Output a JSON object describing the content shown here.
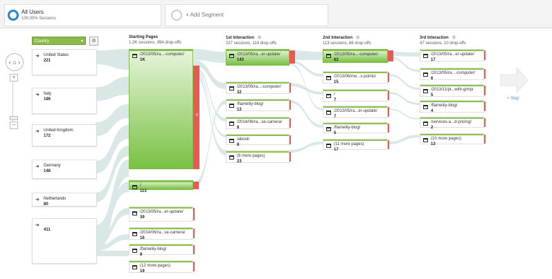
{
  "segments": {
    "all_users": {
      "title": "All Users",
      "subtitle": "100.00% Sessions"
    },
    "add_segment": {
      "label": "+ Add Segment"
    }
  },
  "dimension": {
    "selector_label": "Country",
    "nodes": [
      {
        "name": "United States",
        "count": "221"
      },
      {
        "name": "Italy",
        "count": "189"
      },
      {
        "name": "United Kingdom",
        "count": "172"
      },
      {
        "name": "Germany",
        "count": "148"
      },
      {
        "name": "Netherlands",
        "count": "80"
      },
      {
        "name": "",
        "count": "411"
      }
    ]
  },
  "columns": [
    {
      "title": "Starting Pages",
      "stats": "1.2K sessions, 994 drop-offs",
      "has_icon": false
    },
    {
      "title": "1st Interaction",
      "stats": "227 sessions, 114 drop-offs",
      "has_icon": true
    },
    {
      "title": "2nd Interaction",
      "stats": "113 sessions, 66 drop-offs",
      "has_icon": true
    },
    {
      "title": "3rd Interaction",
      "stats": "47 sessions, 10 drop-offs",
      "has_icon": true
    }
  ],
  "starting_pages": [
    {
      "label": "/2013/05/ra...-computer/",
      "value": "1K"
    },
    {
      "label": "/",
      "value": "113"
    },
    {
      "label": "/2013/05/ra...er-update/",
      "value": "39"
    },
    {
      "label": "/2014/06/ra...se-camera/",
      "value": "16"
    },
    {
      "label": "/flameliiy-blog/",
      "value": "8"
    },
    {
      "label": "(12 more pages)",
      "value": "19"
    }
  ],
  "first_interaction": [
    {
      "label": "/2013/05/ra...er-update/",
      "value": "143"
    },
    {
      "label": "/2013/05/ra...-computer/",
      "value": "32"
    },
    {
      "label": "/flameliiy-blog/",
      "value": "13"
    },
    {
      "label": "/2014/06/ra...se-camera/",
      "value": "8"
    },
    {
      "label": "/about/",
      "value": "8"
    },
    {
      "label": "(9 more pages)",
      "value": "23"
    }
  ],
  "second_interaction": [
    {
      "label": "/2013/05/ra...-computer/",
      "value": "62"
    },
    {
      "label": "/2013/06/me...s-points/",
      "value": "15"
    },
    {
      "label": "/",
      "value": "7"
    },
    {
      "label": "/2013/05/ra...er-update/",
      "value": "7"
    },
    {
      "label": "/flameliiy-blog/",
      "value": "5"
    },
    {
      "label": "(11 more pages)",
      "value": "17"
    }
  ],
  "third_interaction": [
    {
      "label": "/2013/05/ra...er-update/",
      "value": "17"
    },
    {
      "label": "/2013/05/ra...-computer/",
      "value": "6"
    },
    {
      "label": "/2013/11/pl...with-gimp/",
      "value": "5"
    },
    {
      "label": "/flameliiy-blog/",
      "value": "4"
    },
    {
      "label": "/services-a...d-pricing/",
      "value": "2"
    },
    {
      "label": "(10 more pages)",
      "value": "13"
    }
  ],
  "step": {
    "label": "+ Step"
  },
  "drop_off_marker": "8",
  "colors": {
    "accent": "#1e88c9",
    "node_green": "#8bc34a",
    "drop_red": "#e85a4f",
    "flow": "#d4e3e3"
  }
}
